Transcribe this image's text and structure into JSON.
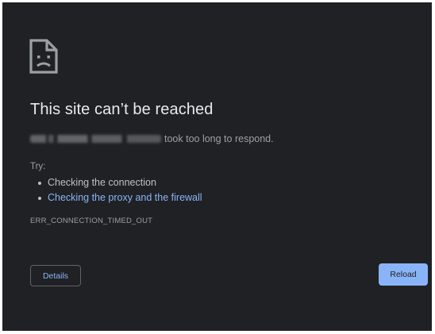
{
  "page": {
    "icon": "sad-document-icon",
    "title": "This site can’t be reached",
    "summary_host_redacted": true,
    "summary_text": "took too long to respond.",
    "try_label": "Try:",
    "suggestions": [
      {
        "text": "Checking the connection",
        "is_link": false
      },
      {
        "text": "Checking the proxy and the firewall",
        "is_link": true
      }
    ],
    "error_code": "ERR_CONNECTION_TIMED_OUT"
  },
  "buttons": {
    "details_label": "Details",
    "reload_label": "Reload"
  },
  "colors": {
    "background": "#202124",
    "title": "#e8eaed",
    "body_text": "#9aa0a6",
    "link": "#8ab4f8",
    "reload_button": "#8ab4f8"
  }
}
